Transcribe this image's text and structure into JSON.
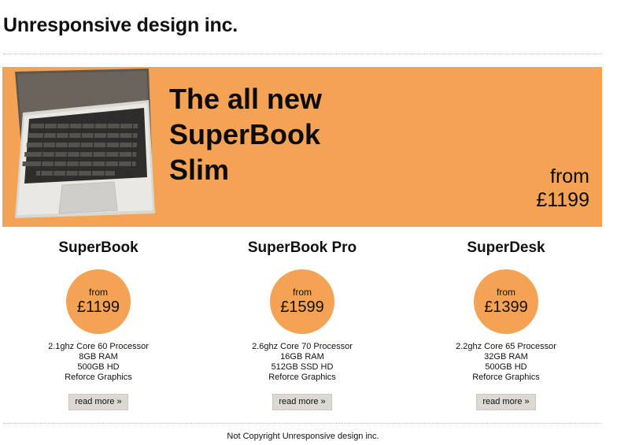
{
  "site": {
    "title": "Unresponsive design inc."
  },
  "hero": {
    "headline_lines": [
      "The all new",
      "SuperBook",
      "Slim"
    ],
    "price_prefix": "from",
    "price": "£1199",
    "image_icon": "laptop-image",
    "background_color": "#f4a254"
  },
  "products": [
    {
      "name": "SuperBook",
      "price_prefix": "from",
      "price": "£1199",
      "specs": [
        "2.1ghz Core 60 Processor",
        "8GB RAM",
        "500GB HD",
        "Reforce Graphics"
      ],
      "button_label": "read more »"
    },
    {
      "name": "SuperBook Pro",
      "price_prefix": "from",
      "price": "£1599",
      "specs": [
        "2.6ghz Core 70 Processor",
        "16GB RAM",
        "512GB SSD HD",
        "Reforce Graphics"
      ],
      "button_label": "read more »"
    },
    {
      "name": "SuperDesk",
      "price_prefix": "from",
      "price": "£1399",
      "specs": [
        "2.2ghz Core 65 Processor",
        "32GB RAM",
        "500GB HD",
        "Reforce Graphics"
      ],
      "button_label": "read more »"
    }
  ],
  "footer": {
    "text": "Not Copyright Unresponsive design inc."
  },
  "colors": {
    "accent": "#f4a254",
    "button_bg": "#dcd9d3",
    "text": "#111111"
  }
}
